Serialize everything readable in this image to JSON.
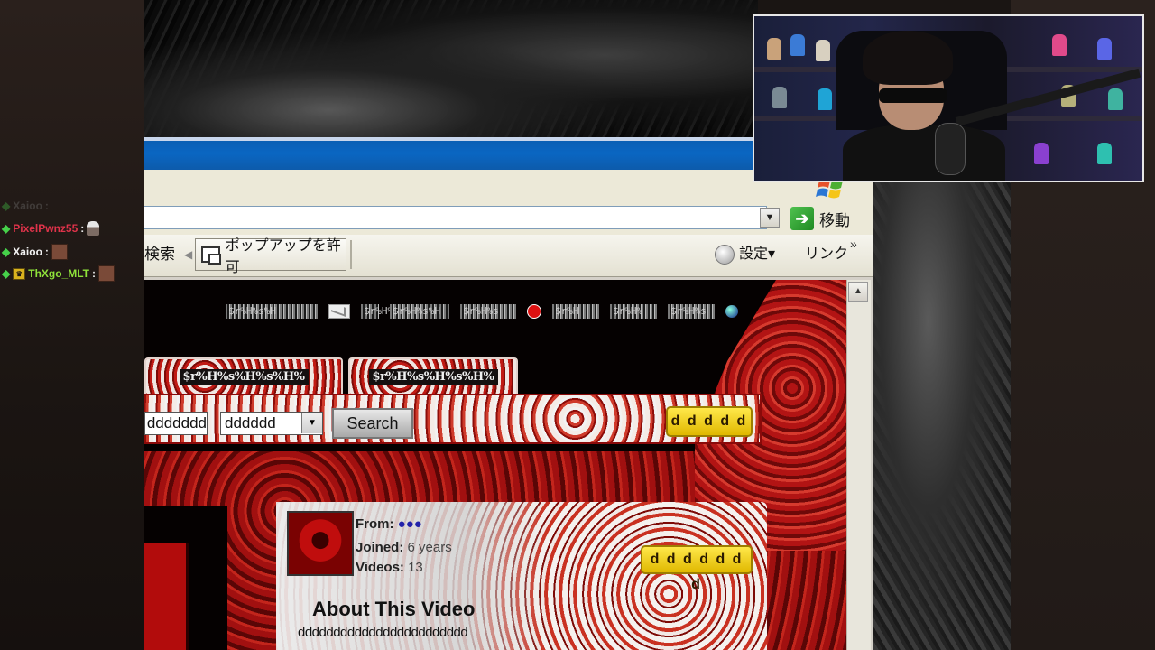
{
  "chat": {
    "messages": [
      {
        "user": "Xaioo",
        "color": "#4a4a4a",
        "faded": true
      },
      {
        "user": "PixelPwnz55",
        "color": "#e0334a"
      },
      {
        "user": "Xaioo",
        "color": "#f2f2f2"
      },
      {
        "user": "ThXgo_MLT",
        "color": "#8fe33a",
        "badge": "crown"
      }
    ],
    "separator": ":"
  },
  "browser": {
    "address_value": "",
    "go_label": "移動",
    "search_label": "検索",
    "popup_label": "ポップアップを許可",
    "settings_label": "設定▾",
    "links_label": "リンク",
    "chevron": "»"
  },
  "page": {
    "nav_items": [
      "$r%H%s%H",
      "$r%H%s",
      "$r%H%s%H",
      "$r%H%s",
      "$r%H",
      "$r%H%",
      "$r%H%s"
    ],
    "tabs": [
      "$r%H%s%H%s%H%",
      "$r%H%s%H%s%H%"
    ],
    "search_text_value": "ddddddd",
    "search_select_value": "dddddd",
    "search_button_label": "Search",
    "yellow_button_1": "d d d d d",
    "profile": {
      "from_label": "From:",
      "from_value": "●●●",
      "joined_label": "Joined:",
      "joined_value": "6 years",
      "videos_label": "Videos:",
      "videos_value": "13"
    },
    "yellow_button_2": "d d d d d d d",
    "about_title": "About This Video",
    "about_text": "dddddddddddddddddddddddd"
  },
  "colors": {
    "ie_title": "#0a66c2",
    "page_red": "#a11010",
    "yellow_button": "#ffe84a"
  },
  "icons": [
    "diamond-icon",
    "crown-badge-icon",
    "emote-icon",
    "windows-logo-icon",
    "go-arrow-icon",
    "popup-blocker-icon",
    "settings-icon",
    "mail-icon",
    "globe-icon",
    "scroll-up-icon",
    "dropdown-arrow-icon"
  ]
}
